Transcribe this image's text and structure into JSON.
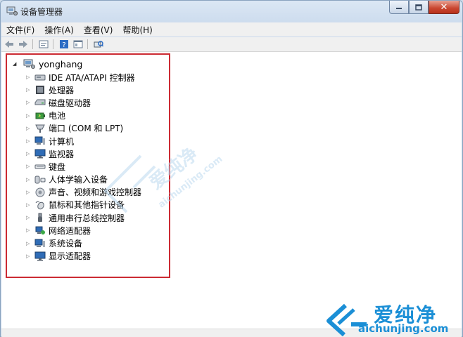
{
  "window": {
    "title": "设备管理器"
  },
  "title_buttons": {
    "minimize": "minimize-icon",
    "maximize": "maximize-icon",
    "close": "✕"
  },
  "menu": [
    "文件(F)",
    "操作(A)",
    "查看(V)",
    "帮助(H)"
  ],
  "toolbar": [
    "back-icon",
    "forward-icon",
    "properties-icon",
    "help-icon",
    "view-icon",
    "scan-hardware-icon"
  ],
  "tree": {
    "root": "yonghang",
    "items": [
      {
        "label": "IDE ATA/ATAPI 控制器",
        "icon": "disk-controller-icon"
      },
      {
        "label": "处理器",
        "icon": "processor-icon"
      },
      {
        "label": "磁盘驱动器",
        "icon": "disk-drive-icon"
      },
      {
        "label": "电池",
        "icon": "battery-icon"
      },
      {
        "label": "端口 (COM 和 LPT)",
        "icon": "port-icon"
      },
      {
        "label": "计算机",
        "icon": "computer-icon"
      },
      {
        "label": "监视器",
        "icon": "monitor-icon"
      },
      {
        "label": "键盘",
        "icon": "keyboard-icon"
      },
      {
        "label": "人体学输入设备",
        "icon": "hid-icon"
      },
      {
        "label": "声音、视频和游戏控制器",
        "icon": "sound-icon"
      },
      {
        "label": "鼠标和其他指针设备",
        "icon": "mouse-icon"
      },
      {
        "label": "通用串行总线控制器",
        "icon": "usb-icon"
      },
      {
        "label": "网络适配器",
        "icon": "network-icon"
      },
      {
        "label": "系统设备",
        "icon": "system-icon"
      },
      {
        "label": "显示适配器",
        "icon": "display-adapter-icon"
      }
    ]
  },
  "watermark": {
    "title": "爱纯净",
    "url": "aichunjing.com",
    "color": "#1b8fd6"
  },
  "accent": "#cc2b33"
}
